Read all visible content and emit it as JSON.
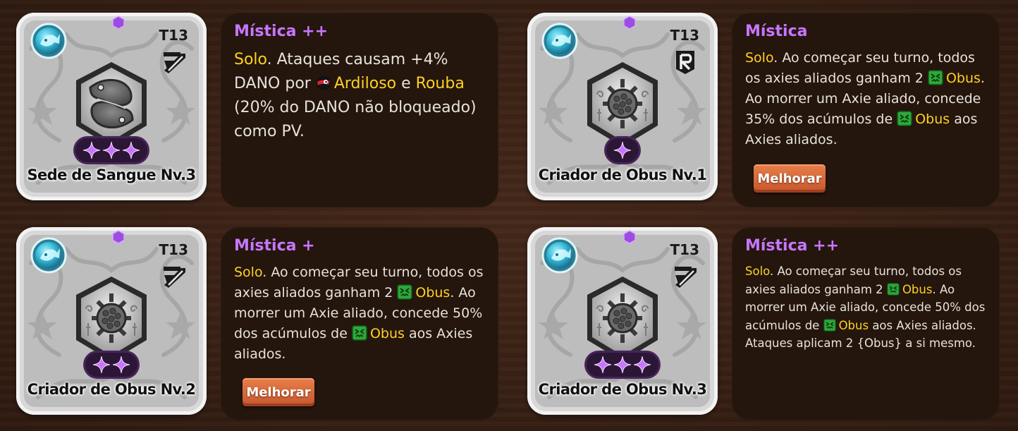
{
  "colors": {
    "rarity": "#c776ff",
    "keyword": "#ffd21f",
    "panel": "#24150d",
    "upgrade": "#d96a3a"
  },
  "cards": [
    {
      "tier": "T13",
      "name": "Sede de Sangue Nv.3",
      "stars": 3,
      "type_icon": "slash-strike-icon",
      "emblem_icon": "twin-fish-emblem-icon",
      "rarity": "Mística ++",
      "text_parts": {
        "p1": "Solo",
        "p2": ". Ataques causam +4% DANO por ",
        "p3": "Ardiloso",
        "p4": " e ",
        "p5": "Rouba",
        "p6": " (20% do DANO não bloqueado) como PV."
      }
    },
    {
      "tier": "T13",
      "name": "Criador de Obus Nv.1",
      "stars": 1,
      "type_icon": "rune-r-icon",
      "emblem_icon": "spiked-mine-emblem-icon",
      "rarity": "Mística",
      "upgrade_label": "Melhorar",
      "text_parts": {
        "p1": "Solo",
        "p2": ". Ao começar seu turno, todos os axies aliados ganham 2 ",
        "p3": "Obus",
        "p4": ". Ao morrer um Axie aliado, concede 35% dos acúmulos de ",
        "p5": "Obus",
        "p6": " aos Axies aliados."
      }
    },
    {
      "tier": "T13",
      "name": "Criador de Obus Nv.2",
      "stars": 2,
      "type_icon": "slash-strike-icon",
      "emblem_icon": "spiked-mine-emblem-icon",
      "rarity": "Mística +",
      "upgrade_label": "Melhorar",
      "text_parts": {
        "p1": "Solo",
        "p2": ". Ao começar seu turno, todos os axies aliados ganham 2 ",
        "p3": "Obus",
        "p4": ". Ao morrer um Axie aliado, concede 50% dos acúmulos de ",
        "p5": "Obus",
        "p6": " aos Axies aliados."
      }
    },
    {
      "tier": "T13",
      "name": "Criador de Obus Nv.3",
      "stars": 3,
      "type_icon": "slash-strike-icon",
      "emblem_icon": "spiked-mine-emblem-icon",
      "rarity": "Mística ++",
      "text_parts": {
        "p1": "Solo",
        "p2": ". Ao começar seu turno, todos os axies aliados ganham 2 ",
        "p3": "Obus",
        "p4": ". Ao morrer um Axie aliado, concede 50% dos acúmulos de ",
        "p5": "Obus",
        "p6": " aos Axies aliados. Ataques aplicam 2 {Obus} a si mesmo."
      }
    }
  ]
}
